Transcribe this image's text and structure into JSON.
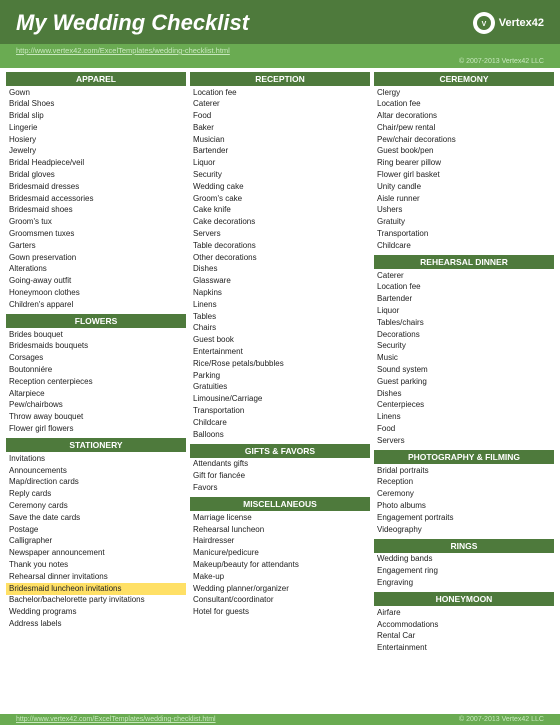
{
  "header": {
    "title": "My Wedding Checklist",
    "logo_text": "Vertex42",
    "url": "http://www.vertex42.com/ExcelTemplates/wedding-checklist.html",
    "copyright": "© 2007-2013 Vertex42 LLC"
  },
  "footer": {
    "url": "http://www.vertex42.com/ExcelTemplates/wedding-checklist.html",
    "copyright": "© 2007-2013 Vertex42 LLC"
  },
  "columns": [
    {
      "sections": [
        {
          "header": "APPAREL",
          "items": [
            "Gown",
            "Bridal Shoes",
            "Bridal slip",
            "Lingerie",
            "Hosiery",
            "Jewelry",
            "Bridal Headpiece/veil",
            "Bridal gloves",
            "Bridesmaid dresses",
            "Bridesmaid accessories",
            "Bridesmaid shoes",
            "Groom's tux",
            "Groomsmen tuxes",
            "Garters",
            "Gown preservation",
            "Alterations",
            "Going-away outfit",
            "Honeymoon clothes",
            "Children's apparel"
          ]
        },
        {
          "header": "FLOWERS",
          "items": [
            "Brides bouquet",
            "Bridesmaids bouquets",
            "Corsages",
            "Boutonniére",
            "Reception centerpieces",
            "Altarpiece",
            "Pew/chairbows",
            "Throw away bouquet",
            "Flower girl flowers"
          ]
        },
        {
          "header": "STATIONERY",
          "items": [
            "Invitations",
            "Announcements",
            "Map/direction cards",
            "Reply cards",
            "Ceremony cards",
            "Save the date cards",
            "Postage",
            "Calligrapher",
            "Newspaper announcement",
            "Thank you notes",
            "Rehearsal dinner invitations",
            "Bridesmaid luncheon invitations",
            "Bachelor/bachelorette party invitations",
            "Wedding programs",
            "Address labels"
          ],
          "special": [
            11
          ]
        }
      ]
    },
    {
      "sections": [
        {
          "header": "RECEPTION",
          "items": [
            "Location fee",
            "Caterer",
            "Food",
            "Baker",
            "Musician",
            "Bartender",
            "Liquor",
            "Security",
            "Wedding cake",
            "Groom's cake",
            "Cake knife",
            "Cake decorations",
            "Servers",
            "Table decorations",
            "Other decorations",
            "Dishes",
            "Glassware",
            "Napkins",
            "Linens",
            "Tables",
            "Chairs",
            "Guest book",
            "Entertainment",
            "Rice/Rose petals/bubbles",
            "Parking",
            "Gratuities",
            "Limousine/Carriage",
            "Transportation",
            "Childcare",
            "Balloons"
          ]
        },
        {
          "header": "GIFTS & FAVORS",
          "items": [
            "Attendants gifts",
            "Gift for fiancée",
            "Favors"
          ]
        },
        {
          "header": "MISCELLANEOUS",
          "items": [
            "Marriage license",
            "Rehearsal luncheon",
            "Hairdresser",
            "Manicure/pedicure",
            "Makeup/beauty for attendants",
            "Make-up",
            "Wedding planner/organizer",
            "Consultant/coordinator",
            "Hotel for guests"
          ]
        }
      ]
    },
    {
      "sections": [
        {
          "header": "CEREMONY",
          "items": [
            "Clergy",
            "Location fee",
            "Altar decorations",
            "Chair/pew rental",
            "Pew/chair decorations",
            "Guest book/pen",
            "Ring bearer pillow",
            "Flower girl basket",
            "Unity candle",
            "Aisle runner",
            "Ushers",
            "Gratuity",
            "Transportation",
            "Childcare"
          ]
        },
        {
          "header": "REHEARSAL DINNER",
          "items": [
            "Caterer",
            "Location fee",
            "Bartender",
            "Liquor",
            "Tables/chairs",
            "Decorations",
            "Security",
            "Music",
            "Sound system",
            "Guest parking",
            "Dishes",
            "Centerpieces",
            "Linens",
            "Food",
            "Servers"
          ]
        },
        {
          "header": "PHOTOGRAPHY & FILMING",
          "items": [
            "Bridal portraits",
            "Reception",
            "Ceremony",
            "Photo albums",
            "Engagement portraits",
            "Videography"
          ]
        },
        {
          "header": "RINGS",
          "items": [
            "Wedding bands",
            "Engagement ring",
            "Engraving"
          ]
        },
        {
          "header": "HONEYMOON",
          "items": [
            "Airfare",
            "Accommodations",
            "Rental Car",
            "Entertainment"
          ]
        }
      ]
    }
  ]
}
